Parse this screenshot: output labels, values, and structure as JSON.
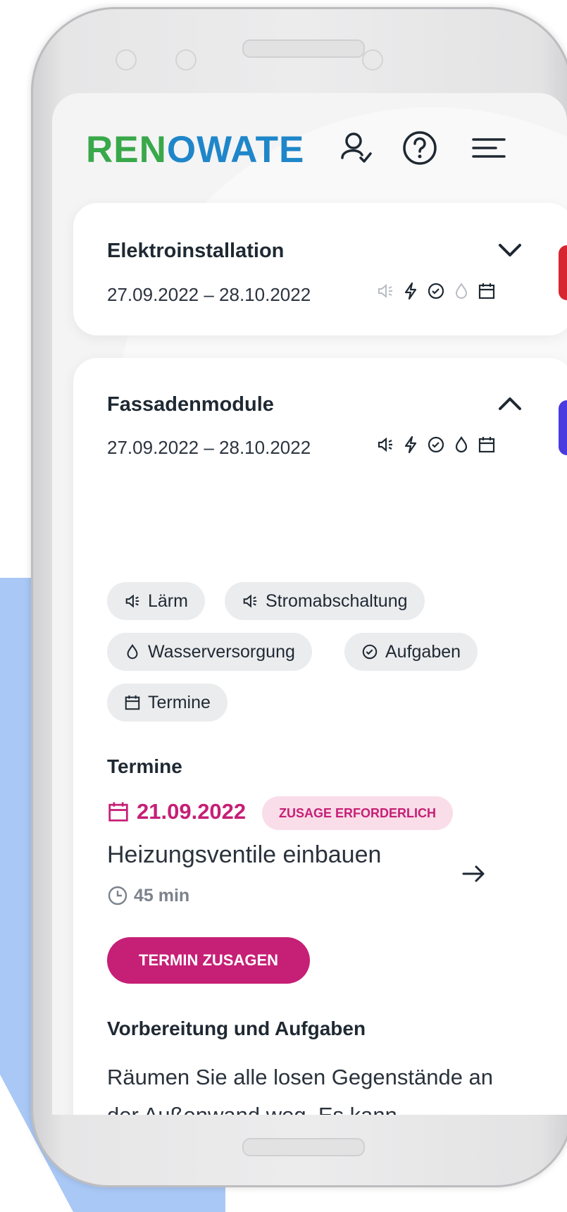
{
  "brand": {
    "logo_text_green": "REN",
    "logo_text_o": "O",
    "logo_text_blue": "WATE",
    "green": "#39a84a",
    "blue": "#1f86c9"
  },
  "header": {
    "icons": [
      "user-check-icon",
      "help-circle-icon",
      "menu-icon"
    ]
  },
  "cards": [
    {
      "title": "Elektroinstallation",
      "date_range": "27.09.2022 – 28.10.2022",
      "expanded": false,
      "accent": "#d7262f",
      "status_icons": [
        "speaker-icon",
        "bolt-icon",
        "check-circle-icon",
        "drop-icon",
        "calendar-icon"
      ]
    },
    {
      "title": "Fassadenmodule",
      "date_range": "27.09.2022 – 28.10.2022",
      "expanded": true,
      "accent": "#4a3be0",
      "status_icons": [
        "speaker-icon",
        "bolt-icon",
        "check-circle-icon",
        "drop-icon",
        "calendar-icon"
      ],
      "chips": [
        {
          "label": "Lärm",
          "icon": "speaker-icon"
        },
        {
          "label": "Stromabschaltung",
          "icon": "speaker-icon"
        },
        {
          "label": "Wasserversorgung",
          "icon": "drop-icon"
        },
        {
          "label": "Aufgaben",
          "icon": "check-circle-icon"
        },
        {
          "label": "Termine",
          "icon": "calendar-icon"
        }
      ],
      "termine_heading": "Termine",
      "appointment": {
        "date": "21.09.2022",
        "badge": "ZUSAGE ERFORDERLICH",
        "title": "Heizungsventile einbauen",
        "duration": "45 min",
        "cta": "TERMIN ZUSAGEN"
      },
      "prep_heading": "Vorbereitung und Aufgaben",
      "prep_text": "Räumen Sie alle losen Gegenstände an der Außenwand weg.  Es kann"
    }
  ],
  "colors": {
    "primary": "#c61f76",
    "badge_bg": "#f9dde8",
    "chip_bg": "#ebecee"
  }
}
